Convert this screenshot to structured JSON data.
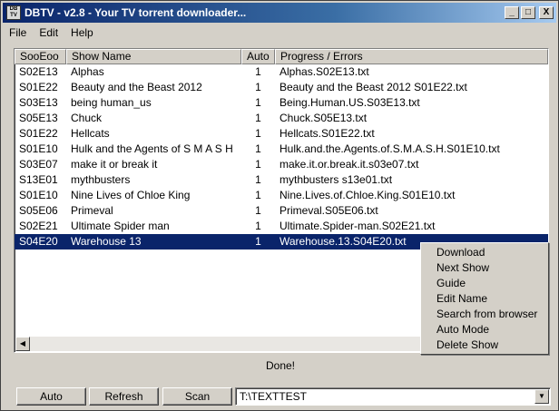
{
  "window": {
    "title": "DBTV - v2.8 - Your TV torrent downloader...",
    "icon_text": "DB TV",
    "controls": [
      "_",
      "□",
      "X"
    ]
  },
  "menu": [
    "File",
    "Edit",
    "Help"
  ],
  "table": {
    "headers": [
      "SooEoo",
      "Show Name",
      "Auto",
      "Progress / Errors"
    ],
    "rows": [
      [
        "S02E13",
        "Alphas",
        "1",
        "Alphas.S02E13.txt"
      ],
      [
        "S01E22",
        "Beauty and the Beast 2012",
        "1",
        "Beauty and the Beast 2012 S01E22.txt"
      ],
      [
        "S03E13",
        "being human_us",
        "1",
        "Being.Human.US.S03E13.txt"
      ],
      [
        "S05E13",
        "Chuck",
        "1",
        "Chuck.S05E13.txt"
      ],
      [
        "S01E22",
        "Hellcats",
        "1",
        "Hellcats.S01E22.txt"
      ],
      [
        "S01E10",
        "Hulk and the Agents of S M A S H",
        "1",
        "Hulk.and.the.Agents.of.S.M.A.S.H.S01E10.txt"
      ],
      [
        "S03E07",
        "make it or break it",
        "1",
        "make.it.or.break.it.s03e07.txt"
      ],
      [
        "S13E01",
        "mythbusters",
        "1",
        "mythbusters s13e01.txt"
      ],
      [
        "S01E10",
        "Nine Lives of Chloe King",
        "1",
        "Nine.Lives.of.Chloe.King.S01E10.txt"
      ],
      [
        "S05E06",
        "Primeval",
        "1",
        "Primeval.S05E06.txt"
      ],
      [
        "S02E21",
        "Ultimate Spider man",
        "1",
        "Ultimate.Spider-man.S02E21.txt"
      ],
      [
        "S04E20",
        "Warehouse 13",
        "1",
        "Warehouse.13.S04E20.txt"
      ]
    ],
    "selected_row": 11
  },
  "context_menu": [
    "Download",
    "Next Show",
    "Guide",
    "Edit Name",
    "Search from browser",
    "Auto Mode",
    "Delete Show"
  ],
  "status": "Done!",
  "buttons": {
    "auto": "Auto",
    "refresh": "Refresh",
    "scan": "Scan"
  },
  "path_combo": {
    "value": "T:\\TEXTTEST"
  },
  "colors": {
    "selection": "#0a246a",
    "titlebar": "#0a246a",
    "face": "#d4d0c8"
  }
}
